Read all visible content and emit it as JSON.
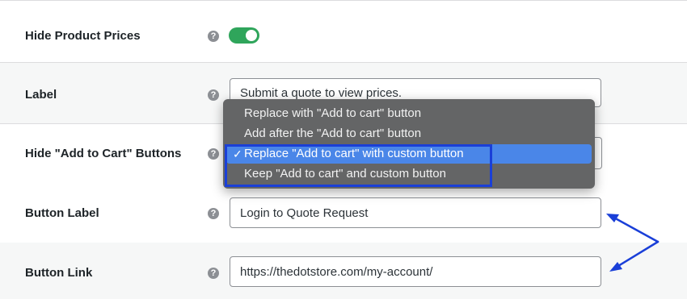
{
  "rows": {
    "hide_prices": {
      "label": "Hide Product Prices",
      "toggle_on": true
    },
    "label": {
      "label": "Label",
      "value": "Submit a quote to view prices."
    },
    "hide_cart": {
      "label": "Hide \"Add to Cart\" Buttons"
    },
    "button_label": {
      "label": "Button Label",
      "value": "Login to Quote Request"
    },
    "button_link": {
      "label": "Button Link",
      "value": "https://thedotstore.com/my-account/"
    }
  },
  "help_icon": {
    "name": "help-icon",
    "glyph": "?"
  },
  "dropdown": {
    "options": [
      "Replace with \"Add to cart\" button",
      "Add after the \"Add to cart\" button",
      "Replace \"Add to cart\" with custom button",
      "Keep \"Add to cart\" and custom button"
    ],
    "selected_index": 2,
    "check_glyph": "✓"
  },
  "colors": {
    "toggle_on": "#2fa55b",
    "dropdown_bg": "#646566",
    "selected_option": "#4a86e8",
    "annotation": "#1a3fd8"
  }
}
